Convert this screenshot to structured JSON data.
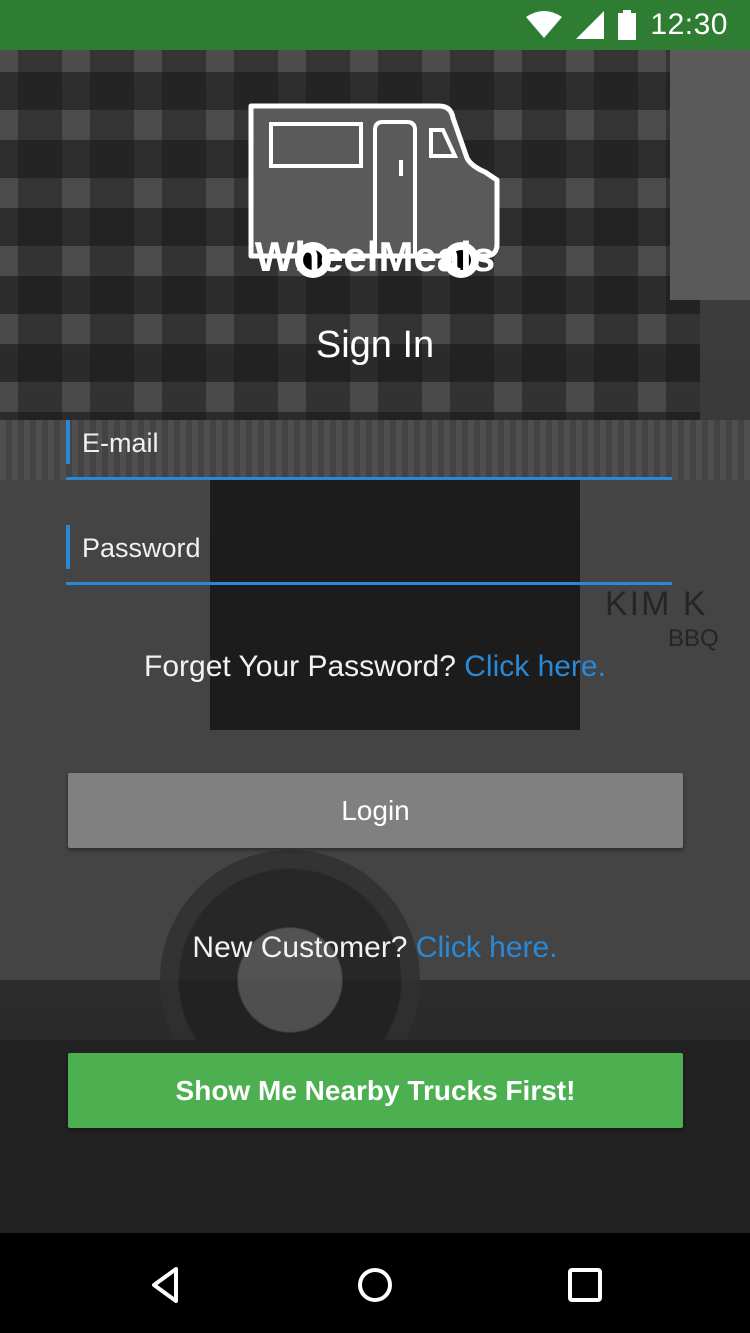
{
  "status_bar": {
    "time": "12:30",
    "icons": [
      "wifi-icon",
      "cell-signal-icon",
      "battery-icon"
    ],
    "background": "#2f7d32"
  },
  "app": {
    "name": "WheelMeals",
    "logo_icon": "food-truck-icon"
  },
  "sign_in": {
    "title": "Sign In",
    "email_placeholder": "E-mail",
    "password_placeholder": "Password",
    "forgot_text": "Forget Your Password?",
    "forgot_link": "Click here.",
    "login_label": "Login",
    "new_customer_text": "New Customer?",
    "new_customer_link": "Click here.",
    "nearby_label": "Show Me Nearby Trucks First!"
  },
  "colors": {
    "accent_blue": "#2a89d6",
    "login_button": "#808080",
    "nearby_button": "#4caf50"
  },
  "nav_bar": {
    "icons": [
      "back-icon",
      "home-icon",
      "recents-icon"
    ]
  }
}
